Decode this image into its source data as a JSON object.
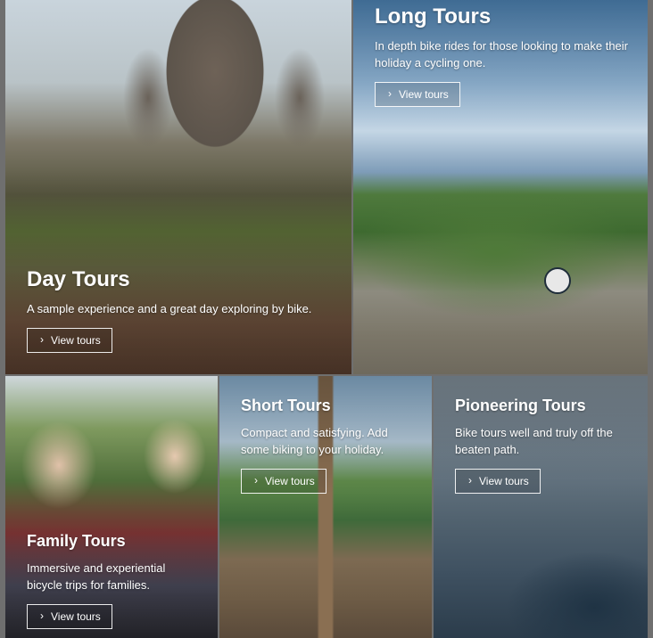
{
  "tiles": {
    "day": {
      "title": "Day Tours",
      "description": "A sample experience and a great day exploring by bike.",
      "button_label": "View tours",
      "button_icon": "chevron-right-icon"
    },
    "long": {
      "title": "Long Tours",
      "description": "In depth bike rides for those looking to make their holiday a cycling one.",
      "button_label": "View tours",
      "button_icon": "chevron-right-icon"
    },
    "family": {
      "title": "Family Tours",
      "description": "Immersive and experiential bicycle trips for families.",
      "button_label": "View tours",
      "button_icon": "chevron-right-icon"
    },
    "short": {
      "title": "Short Tours",
      "description": "Compact and satisfying. Add some biking to your holiday.",
      "button_label": "View tours",
      "button_icon": "chevron-right-icon"
    },
    "pioneering": {
      "title": "Pioneering Tours",
      "description": "Bike tours well and truly off the beaten path.",
      "button_label": "View tours",
      "button_icon": "chevron-right-icon"
    }
  }
}
